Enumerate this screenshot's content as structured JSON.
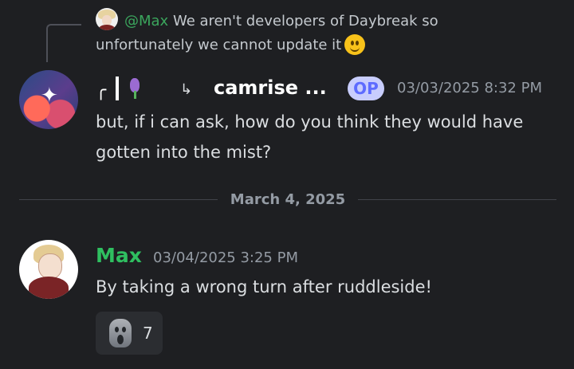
{
  "reply": {
    "mention": "@Max",
    "text": "We aren't developers of Daybreak so unfortunately we cannot update it"
  },
  "message1": {
    "name_prefix_icon": "corner-glyph",
    "username": "camrise ...",
    "badge": "OP",
    "timestamp": "03/03/2025 8:32 PM",
    "text": "but, if i can ask, how do you think they would have gotten into the mist?"
  },
  "date_divider": {
    "text": "March 4, 2025"
  },
  "message2": {
    "username": "Max",
    "timestamp": "03/04/2025 3:25 PM",
    "text": "By taking a wrong turn after ruddleside!",
    "reaction": {
      "emoji": "screaming-ghost-icon",
      "count": "7"
    }
  },
  "colors": {
    "background": "#1e1f22",
    "green": "#2fbf60",
    "muted": "#949ba4",
    "op_badge": "#c8cdfd"
  }
}
